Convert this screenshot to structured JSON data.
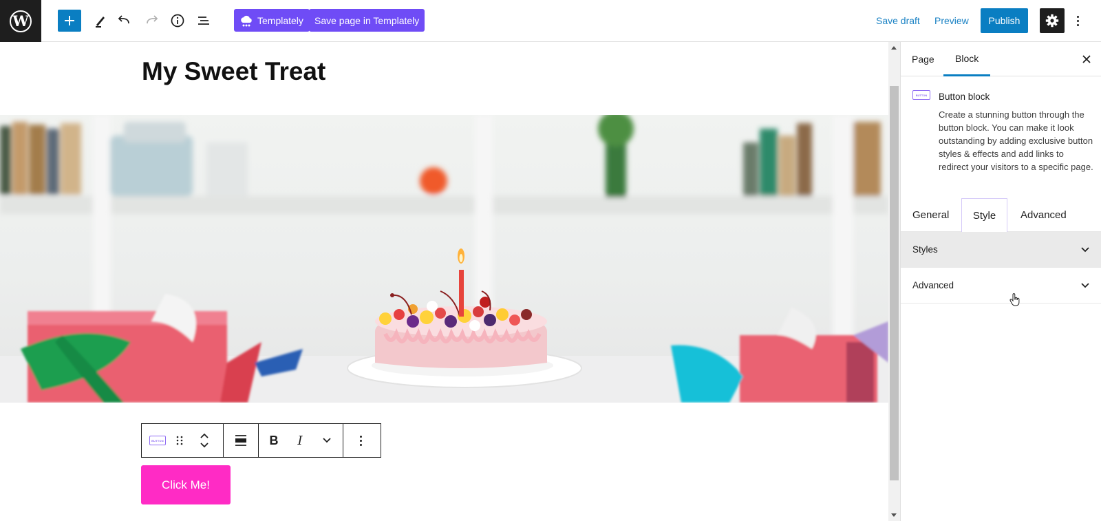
{
  "topbar": {
    "templately_label": "Templately",
    "save_page_templately_label": "Save page in Templately",
    "save_draft_label": "Save draft",
    "preview_label": "Preview",
    "publish_label": "Publish",
    "icons": [
      "wordpress-logo",
      "plus-icon",
      "pencil-icon",
      "undo-icon",
      "redo-icon",
      "info-icon",
      "list-view-icon",
      "gear-icon",
      "more-vertical-icon"
    ]
  },
  "editor": {
    "page_title": "My Sweet Treat",
    "button_text": "Click Me!",
    "button_color": "#ff2bc5",
    "block_badge_text": "BUTTON"
  },
  "sidebar": {
    "tabs": [
      {
        "label": "Page"
      },
      {
        "label": "Block"
      }
    ],
    "active_tab": "Block",
    "block_name": "Button block",
    "block_description": "Create a stunning button through the button block. You can make it look outstanding by adding exclusive button styles & effects and add links to redirect your visitors to a specific page.",
    "inner_tabs": [
      {
        "label": "General"
      },
      {
        "label": "Style"
      },
      {
        "label": "Advanced"
      }
    ],
    "active_inner_tab": "Style",
    "panels": [
      {
        "label": "Styles"
      },
      {
        "label": "Advanced"
      }
    ]
  },
  "colors": {
    "accent": "#0a7ec2",
    "templately": "#6f4cf6"
  }
}
